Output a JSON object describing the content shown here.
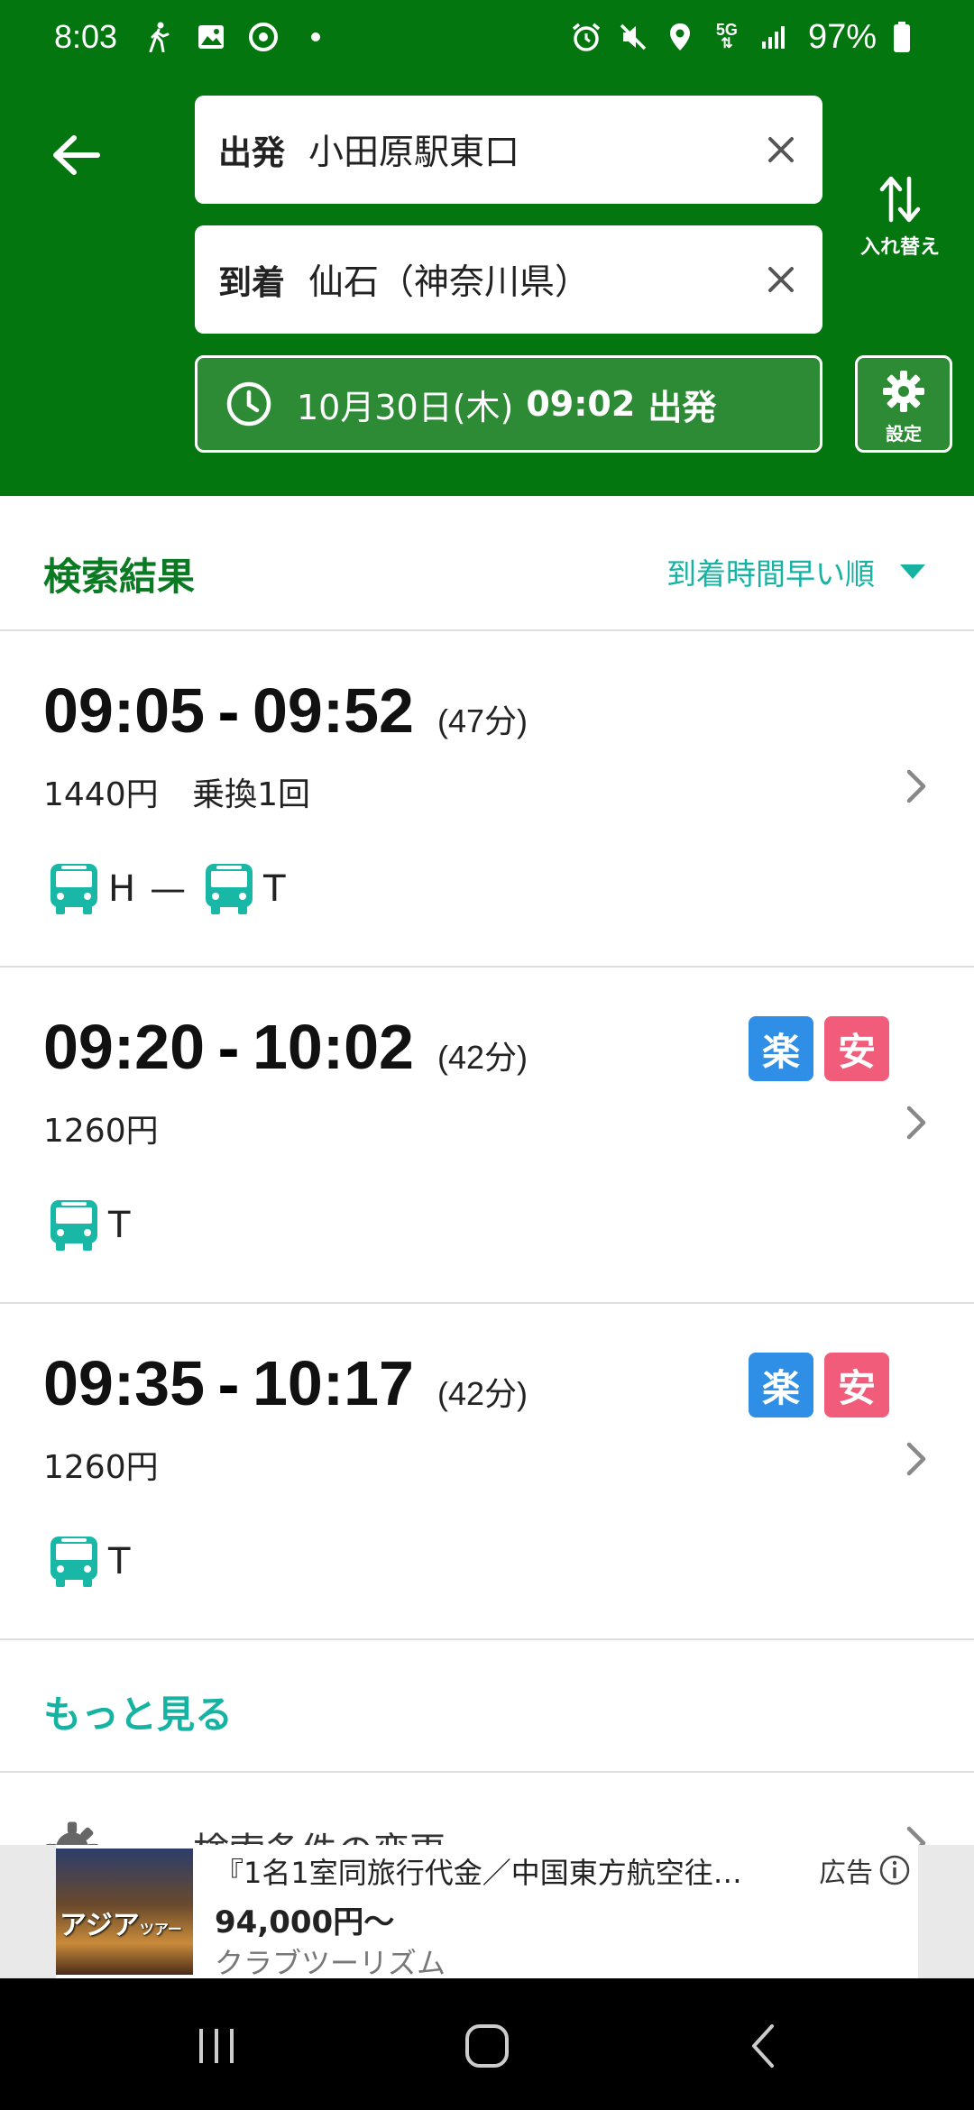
{
  "status_bar": {
    "time": "8:03",
    "battery": "97%",
    "signal_label": "5G"
  },
  "header": {
    "departure_label": "出発",
    "departure_value": "小田原駅東口",
    "arrival_label": "到着",
    "arrival_value": "仙石（神奈川県）",
    "swap_label": "入れ替え",
    "date": "10月30日(木)",
    "time": "09:02",
    "direction": "出発",
    "settings_label": "設定"
  },
  "results": {
    "title": "検索結果",
    "sort": "到着時間早い順"
  },
  "routes": [
    {
      "depart": "09:05",
      "arrive": "09:52",
      "duration": "(47分)",
      "fare": "1440円",
      "transfers": "乗換1回",
      "badges": [],
      "lines": [
        "H",
        "T"
      ]
    },
    {
      "depart": "09:20",
      "arrive": "10:02",
      "duration": "(42分)",
      "fare": "1260円",
      "transfers": "",
      "badges": [
        "楽",
        "安"
      ],
      "lines": [
        "T"
      ]
    },
    {
      "depart": "09:35",
      "arrive": "10:17",
      "duration": "(42分)",
      "fare": "1260円",
      "transfers": "",
      "badges": [
        "楽",
        "安"
      ],
      "lines": [
        "T"
      ]
    }
  ],
  "more_label": "もっと見る",
  "conditions_label": "検索条件の変更",
  "ad": {
    "title": "『1名1室同旅行代金／中国東方航空往…",
    "price": "94,000円〜",
    "sponsor": "クラブツーリズム",
    "label": "広告",
    "image_text": "アジア",
    "image_text_small": "ツアー"
  },
  "colors": {
    "header_green": "#04760f",
    "title_green": "#0a7a23",
    "teal": "#16b3a3",
    "badge_blue": "#2f8fe6",
    "badge_pink": "#f05c7a"
  },
  "icons": {
    "back": "arrow-left-icon",
    "clear": "close-icon",
    "swap": "swap-vertical-icon",
    "clock": "clock-icon",
    "settings": "gear-icon",
    "chevron": "chevron-right-icon",
    "bus": "bus-icon",
    "ad_info": "info-icon"
  }
}
